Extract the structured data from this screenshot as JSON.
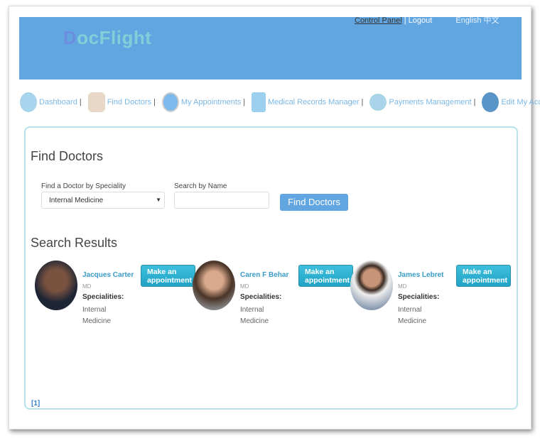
{
  "header": {
    "logo": "DocFlight",
    "control_panel": "Control Panel",
    "separator": "|",
    "logout": "Logout",
    "language": "English 中文",
    "color": "#61a6e0"
  },
  "nav": [
    {
      "label": "Dashboard",
      "icon": "dashboard-icon"
    },
    {
      "label": "Find Doctors",
      "icon": "doctor-icon"
    },
    {
      "label": "My Appointments",
      "icon": "clock-icon"
    },
    {
      "label": "Medical Records Manager",
      "icon": "calendar-icon"
    },
    {
      "label": "Payments Management",
      "icon": "credit-card-icon"
    },
    {
      "label": "Edit My Account",
      "icon": "gear-icon"
    }
  ],
  "main": {
    "title": "Find Doctors",
    "speciality_label": "Find a Doctor by Speciality",
    "speciality_value": "Internal Medicine",
    "name_label": "Search by Name",
    "name_value": "",
    "find_button": "Find Doctors",
    "results_title": "Search Results",
    "pager": "[1]"
  },
  "doctors": [
    {
      "name": "Jacques Carter",
      "degree": "MD",
      "spec_label": "Specialities",
      "specialities": "Internal Medicine",
      "button": "Make an appointment"
    },
    {
      "name": "Caren F Behar",
      "degree": "MD",
      "spec_label": "Specialities",
      "specialities": "Internal Medicine",
      "button": "Make an appointment"
    },
    {
      "name": "James Lebret",
      "degree": "MD",
      "spec_label": "Specialities",
      "specialities": "Internal Medicine",
      "button": "Make an appointment"
    }
  ]
}
